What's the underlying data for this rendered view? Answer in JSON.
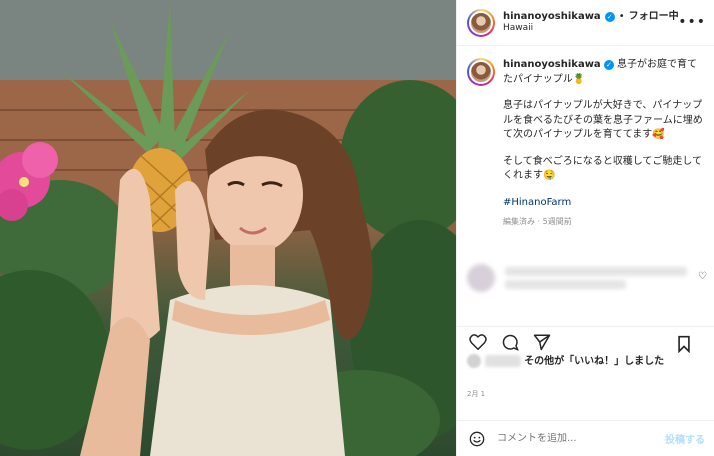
{
  "post": {
    "username": "hinanoyoshikawa",
    "separator": "•",
    "follow_label": "フォロー中",
    "location": "Hawaii",
    "menu_icon": "more-horizontal-icon",
    "caption_title_rest": " 息子がお庭で育てたパイナップル🍍",
    "caption_p1": "息子はパイナップルが大好きで、パイナップルを食べるたびその葉を息子ファームに埋めて次のパイナップルを育ててます🥰",
    "caption_p2": "そして食べごろになると収穫してご馳走してくれます🤤",
    "hashtag": "#HinanoFarm",
    "meta": "編集済み · 5週間前",
    "likes_text": "その他が「いいね！」しました",
    "date": "2月 1",
    "comment_placeholder": "コメントを追加...",
    "post_button": "投稿する"
  },
  "colors": {
    "accent_blue": "#0095f6",
    "post_disabled": "#b2dffc",
    "hashtag": "#00376b",
    "muted": "#8e8e8e"
  }
}
